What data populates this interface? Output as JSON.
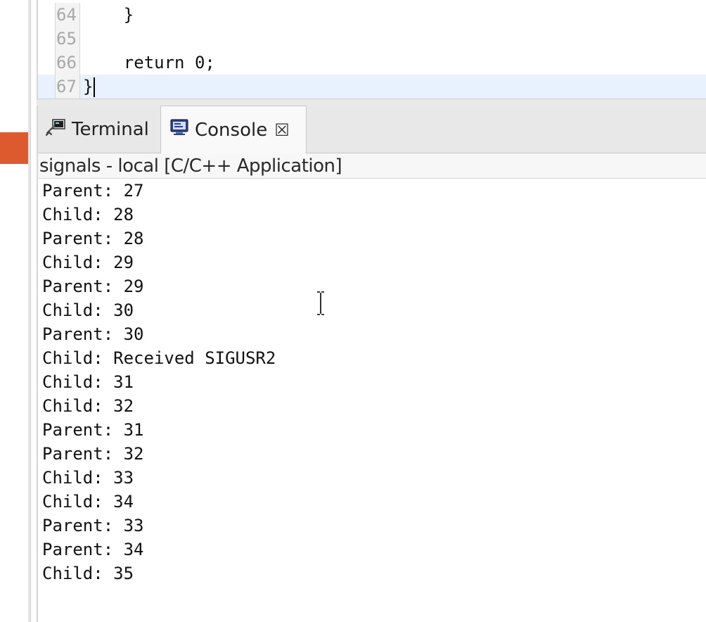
{
  "editor": {
    "lines": [
      {
        "number": "64",
        "code": "    }"
      },
      {
        "number": "65",
        "code": ""
      },
      {
        "number": "66",
        "code": "    return 0;"
      },
      {
        "number": "67",
        "code": "}"
      }
    ]
  },
  "tabs": {
    "terminal_label": "Terminal",
    "console_label": "Console",
    "close_glyph": "☒"
  },
  "console": {
    "header": "signals - local [C/C++ Application]",
    "lines": [
      "Parent: 27",
      "Child: 28",
      "Parent: 28",
      "Child: 29",
      "Parent: 29",
      "Child: 30",
      "Parent: 30",
      "Child: Received SIGUSR2",
      "Child: 31",
      "Child: 32",
      "Parent: 31",
      "Parent: 32",
      "Child: 33",
      "Child: 34",
      "Parent: 33",
      "Parent: 34",
      "Child: 35"
    ]
  },
  "colors": {
    "accent_marker": "#dd5a2e",
    "current_line": "#e8f2fe"
  }
}
